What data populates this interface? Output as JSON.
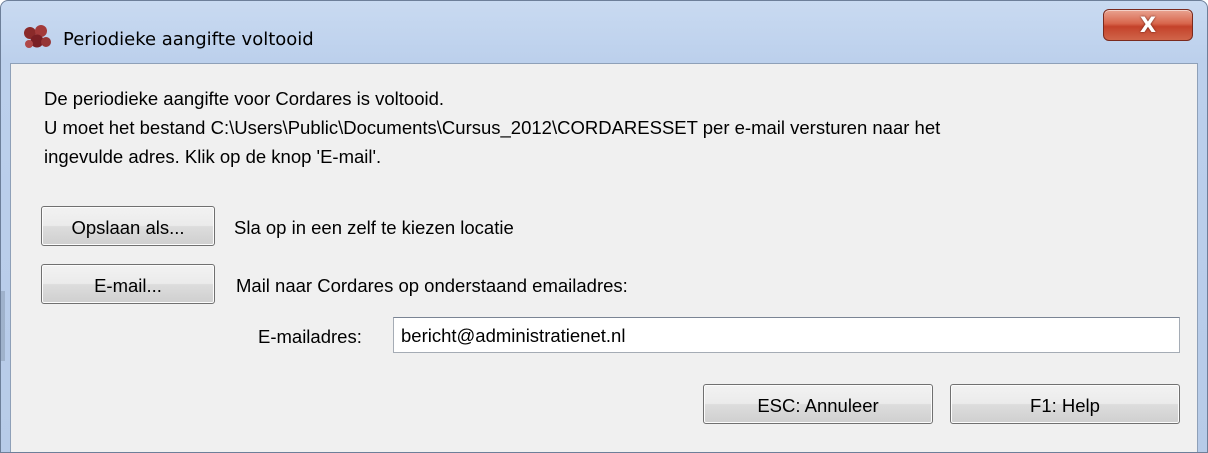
{
  "window": {
    "title": "Periodieke aangifte voltooid",
    "icon": "cordares-app-icon",
    "close_label": "X"
  },
  "message": {
    "line1": "De periodieke aangifte voor Cordares is voltooid.",
    "line2": "U moet het bestand C:\\Users\\Public\\Documents\\Cursus_2012\\CORDARESSET per e-mail versturen naar het",
    "line3": "ingevulde adres. Klik op de knop 'E-mail'."
  },
  "save": {
    "button_label": "Opslaan als...",
    "description": "Sla op in een zelf te kiezen locatie"
  },
  "email": {
    "button_label": "E-mail...",
    "description": "Mail naar Cordares op onderstaand emailadres:",
    "field_label": "E-mailadres:",
    "field_value": "bericht@administratienet.nl"
  },
  "footer": {
    "cancel_label": "ESC: Annuleer",
    "help_label": "F1: Help"
  },
  "colors": {
    "titlebar": "#bcd0ec",
    "client_background": "#f0f0f0",
    "close_button": "#c4422a"
  }
}
